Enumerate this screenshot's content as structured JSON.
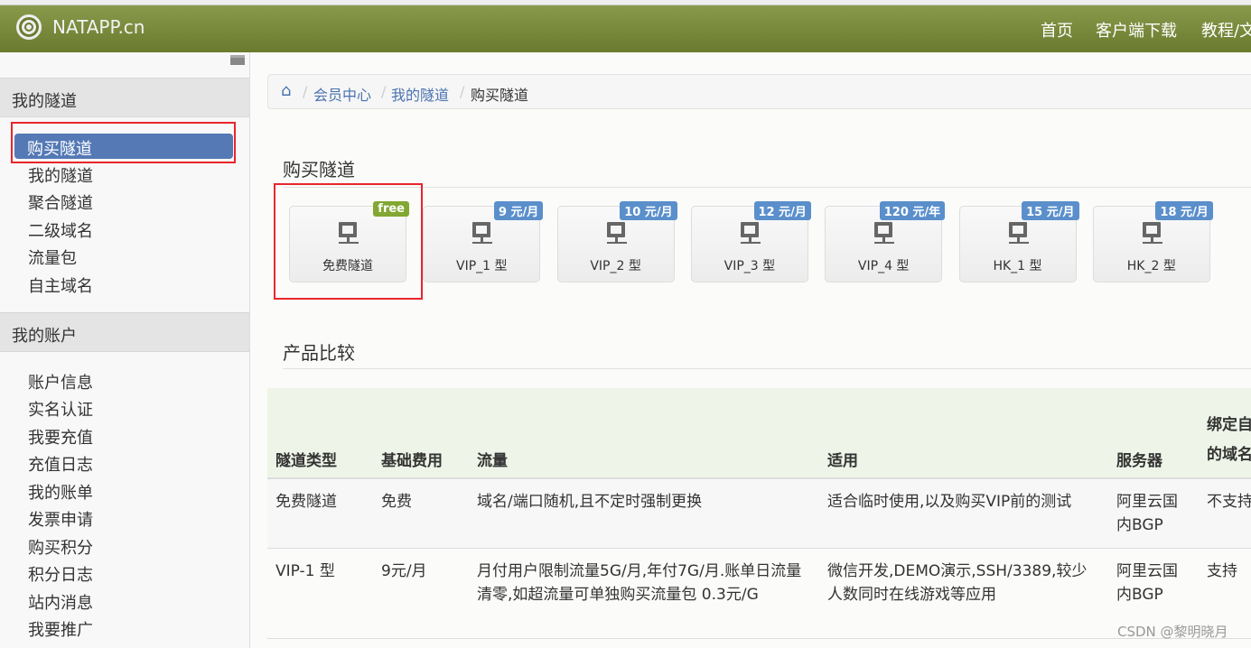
{
  "header": {
    "brand": "NATAPP.cn",
    "nav": [
      "首页",
      "客户端下载",
      "教程/文"
    ]
  },
  "sidebar": {
    "section1": "我的隧道",
    "items1": [
      "购买隧道",
      "我的隧道",
      "聚合隧道",
      "二级域名",
      "流量包",
      "自主域名"
    ],
    "section2": "我的账户",
    "items2": [
      "账户信息",
      "实名认证",
      "我要充值",
      "充值日志",
      "我的账单",
      "发票申请",
      "购买积分",
      "积分日志",
      "站内消息",
      "我要推广"
    ]
  },
  "breadcrumb": [
    "会员中心",
    "我的隧道",
    "购买隧道"
  ],
  "buy_title": "购买隧道",
  "cards": [
    {
      "label": "免费隧道",
      "badge": "free",
      "color": "#82a732"
    },
    {
      "label": "VIP_1 型",
      "badge": "9 元/月",
      "color": "#5a8fcb"
    },
    {
      "label": "VIP_2 型",
      "badge": "10 元/月",
      "color": "#5a8fcb"
    },
    {
      "label": "VIP_3 型",
      "badge": "12 元/月",
      "color": "#5a8fcb"
    },
    {
      "label": "VIP_4 型",
      "badge": "120 元/年",
      "color": "#5a8fcb"
    },
    {
      "label": "HK_1 型",
      "badge": "15 元/月",
      "color": "#5a8fcb"
    },
    {
      "label": "HK_2 型",
      "badge": "18 元/月",
      "color": "#5a8fcb"
    }
  ],
  "compare_title": "产品比较",
  "table": {
    "headers": [
      "隧道类型",
      "基础费用",
      "流量",
      "适用",
      "服务器",
      "绑定自己的域名"
    ],
    "rows": [
      [
        "免费隧道",
        "免费",
        "域名/端口随机,且不定时强制更换",
        "适合临时使用,以及购买VIP前的测试",
        "阿里云国内BGP",
        "不支持"
      ],
      [
        "VIP-1 型",
        "9元/月",
        "月付用户限制流量5G/月,年付7G/月.账单日流量清零,如超流量可单独购买流量包 0.3元/G",
        "微信开发,DEMO演示,SSH/3389,较少人数同时在线游戏等应用",
        "阿里云国内BGP",
        "支持"
      ]
    ]
  },
  "watermark": "CSDN @黎明晓月"
}
